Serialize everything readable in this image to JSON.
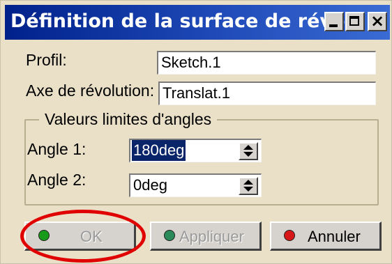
{
  "window": {
    "title": "Définition de la surface de révol..."
  },
  "fields": {
    "profile": {
      "label": "Profil:",
      "value": "Sketch.1"
    },
    "axis": {
      "label": "Axe de révolution:",
      "value": "Translat.1"
    }
  },
  "angles_group": {
    "title": "Valeurs limites d'angles",
    "angle1": {
      "label": "Angle 1:",
      "value": "180deg"
    },
    "angle2": {
      "label": "Angle 2:",
      "value": "0deg"
    }
  },
  "buttons": {
    "ok": {
      "label": "OK",
      "dot_color": "#1a9a1a"
    },
    "apply": {
      "label": "Appliquer",
      "dot_color": "#2a8a5a"
    },
    "cancel": {
      "label": "Annuler",
      "dot_color": "#d81818"
    }
  },
  "colors": {
    "titlebar": "#00218a",
    "dialog_bg": "#eae0c8",
    "highlight": "#e00000"
  }
}
